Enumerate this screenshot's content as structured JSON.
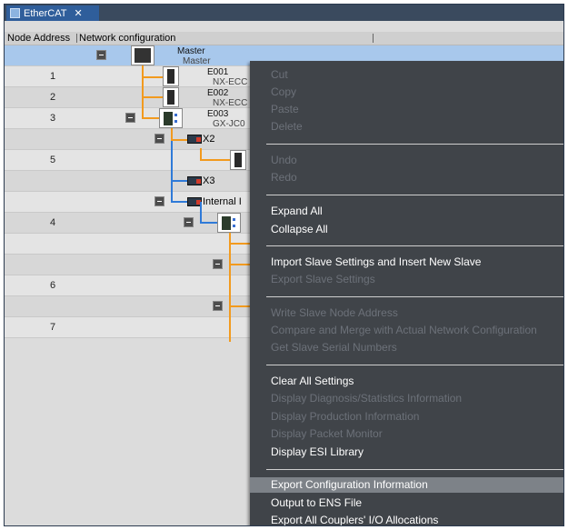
{
  "tab": {
    "title": "EtherCAT",
    "close": "✕"
  },
  "columns": {
    "node_address": "Node Address",
    "network_configuration": "Network configuration"
  },
  "rows": [
    {
      "num": "",
      "name": "Master",
      "model": "Master"
    },
    {
      "num": "1",
      "name": "E001",
      "model": "NX-ECC"
    },
    {
      "num": "2",
      "name": "E002",
      "model": "NX-ECC"
    },
    {
      "num": "3",
      "name": "E003",
      "model": "GX-JC0"
    },
    {
      "num": "",
      "port": "X2"
    },
    {
      "num": "5"
    },
    {
      "num": "",
      "port": "X3"
    },
    {
      "num": "",
      "port": "Internal I"
    },
    {
      "num": "4"
    },
    {
      "num": ""
    },
    {
      "num": ""
    },
    {
      "num": "6"
    },
    {
      "num": ""
    },
    {
      "num": "7"
    }
  ],
  "menu": {
    "cut": "Cut",
    "copy": "Copy",
    "paste": "Paste",
    "delete": "Delete",
    "undo": "Undo",
    "redo": "Redo",
    "expand_all": "Expand All",
    "collapse_all": "Collapse All",
    "import_slave": "Import Slave Settings and Insert New Slave",
    "export_slave": "Export Slave Settings",
    "write_node": "Write Slave Node Address",
    "compare_merge": "Compare and Merge with Actual Network Configuration",
    "get_serial": "Get Slave Serial Numbers",
    "clear_all": "Clear All Settings",
    "diag_stats": "Display Diagnosis/Statistics Information",
    "production": "Display Production Information",
    "packet_monitor": "Display Packet Monitor",
    "esi_library": "Display ESI Library",
    "export_config": "Export Configuration Information",
    "output_ens": "Output to ENS File",
    "export_couplers": "Export All Couplers' I/O Allocations"
  }
}
